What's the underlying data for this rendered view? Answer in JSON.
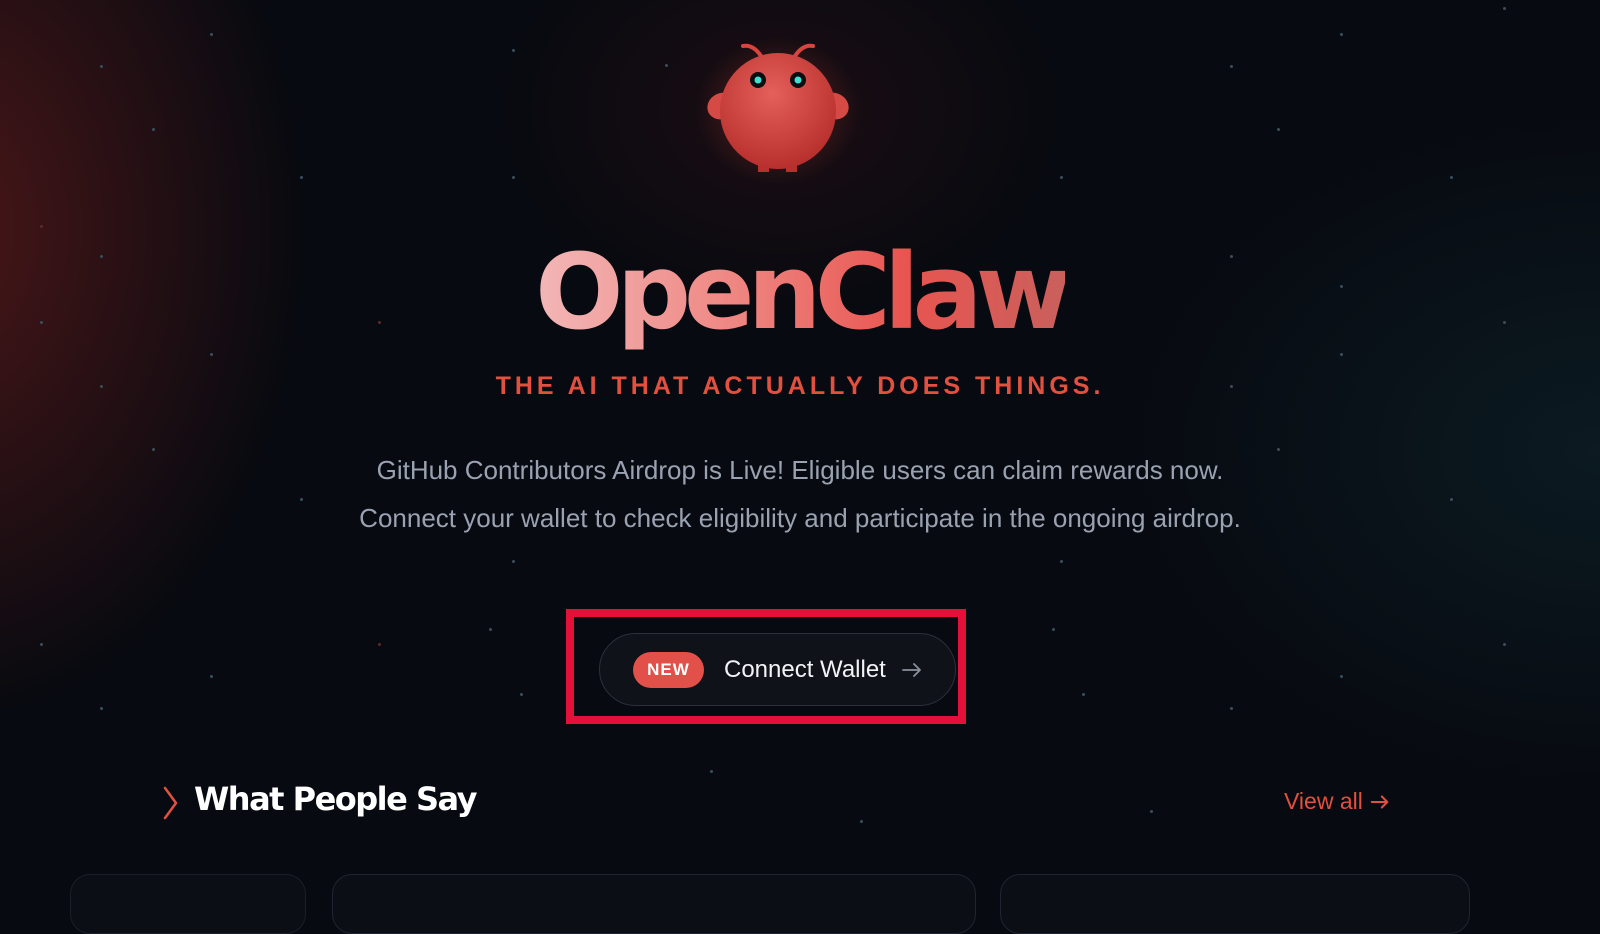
{
  "brand": {
    "name": "OpenClaw",
    "tagline": "THE AI THAT ACTUALLY DOES THINGS."
  },
  "hero": {
    "description_line1": "GitHub Contributors Airdrop is Live! Eligible users can claim rewards now.",
    "description_line2": "Connect your wallet to check eligibility and participate in the ongoing airdrop."
  },
  "cta": {
    "badge": "NEW",
    "label": "Connect Wallet",
    "icon": "arrow-right-icon"
  },
  "testimonials": {
    "title": "What People Say",
    "view_all": "View all",
    "view_all_icon": "arrow-right-icon",
    "section_icon": "chevron-right-icon"
  },
  "colors": {
    "background": "#070a10",
    "accent": "#e2503f",
    "highlight_box": "#e3113a",
    "badge": "#e2504a",
    "text_muted": "#9aa2b2"
  }
}
